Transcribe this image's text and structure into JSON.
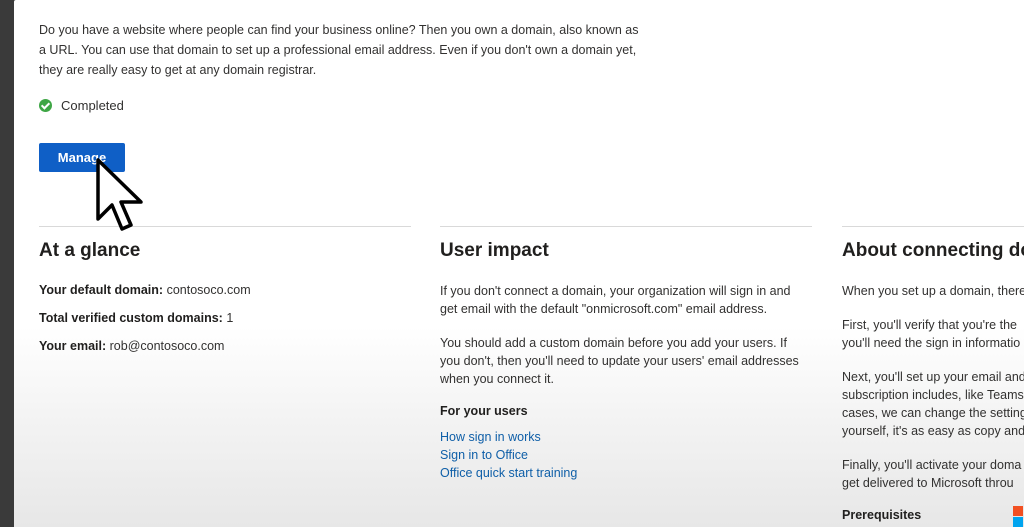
{
  "intro_text": "Do you have a website where people can find your business online? Then you own a domain, also known as a URL. You can use that domain to set up a professional email address. Even if you don't own a domain yet, they are really easy to get at any domain registrar.",
  "status": {
    "label": "Completed",
    "color": "#3ea645"
  },
  "manage_button": {
    "label": "Manage",
    "color": "#0f5fc6"
  },
  "at_a_glance": {
    "title": "At a glance",
    "rows": [
      {
        "label": "Your default domain:",
        "value": "contosoco.com"
      },
      {
        "label": "Total verified custom domains:",
        "value": "1"
      },
      {
        "label": "Your email:",
        "value": "rob@contosoco.com"
      }
    ]
  },
  "user_impact": {
    "title": "User impact",
    "paragraphs": [
      "If you don't connect a domain, your organization will sign in and get email with the default \"onmicrosoft.com\" email address.",
      "You should add a custom domain before you add your users. If you don't, then you'll need to update your users' email addresses when you connect it."
    ],
    "subheading": "For your users",
    "links": [
      "How sign in works",
      "Sign in to Office",
      "Office quick start training"
    ]
  },
  "about": {
    "title": "About connecting do",
    "lines": [
      [
        "When you set up a domain, there"
      ],
      [
        "First, you'll verify that you're the",
        "you'll need the sign in informatio"
      ],
      [
        "Next, you'll set up your email and",
        "subscription includes, like Teams",
        "cases, we can change the setting",
        "yourself, it's as easy as copy and"
      ],
      [
        "Finally, you'll activate your doma",
        "get delivered to Microsoft throu"
      ]
    ],
    "prerequisites": "Prerequisites"
  },
  "link_color": "#0f5fa8"
}
